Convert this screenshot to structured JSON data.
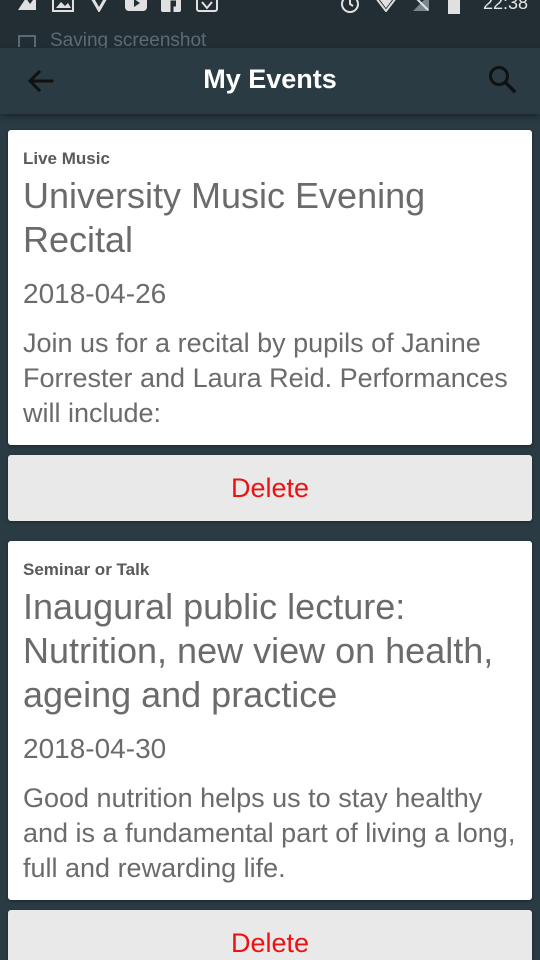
{
  "status_bar": {
    "time": "22:38",
    "notification_text": "Saving screenshot"
  },
  "app_bar": {
    "title": "My Events"
  },
  "events": [
    {
      "category": "Live Music",
      "title": "University Music Evening Recital",
      "date": "2018-04-26",
      "description": "Join us for a recital by pupils of Janine Forrester and Laura Reid. Performances will include:",
      "delete_label": "Delete"
    },
    {
      "category": "Seminar or Talk",
      "title": "Inaugural public lecture: Nutrition, new view on health, ageing and practice",
      "date": "2018-04-30",
      "description": "Good nutrition helps us to stay healthy and is a fundamental part of living a long, full and rewarding life.",
      "delete_label": "Delete"
    }
  ],
  "colors": {
    "app_bar": "#2a3b44",
    "delete_text": "#ee1111",
    "card_text": "#6b6b6b"
  }
}
